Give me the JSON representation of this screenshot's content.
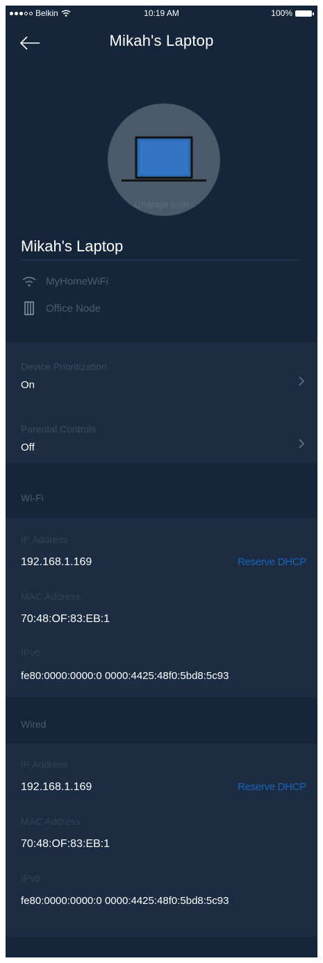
{
  "status_bar": {
    "carrier": "Belkin",
    "time": "10:19 AM",
    "battery": "100%"
  },
  "nav": {
    "title": "Mikah's Laptop"
  },
  "device": {
    "change_icon_label": "Change Icon",
    "name": "Mikah's Laptop",
    "network": "MyHomeWiFi",
    "node": "Office Node"
  },
  "settings": {
    "prioritization": {
      "label": "Device Prioritization",
      "value": "On"
    },
    "parental": {
      "label": "Parental Controls",
      "value": "Off"
    }
  },
  "wifi": {
    "header": "Wi-Fi",
    "ip_label": "IP Address",
    "ip_value": "192.168.1.169",
    "reserve_label": "Reserve DHCP",
    "mac_label": "MAC Address",
    "mac_value": "70:48:OF:83:EB:1",
    "ipv6_label": "IPv6",
    "ipv6_value": "fe80:0000:0000:0 0000:4425:48f0:5bd8:5c93"
  },
  "wired": {
    "header": "Wired",
    "ip_label": "IP Address",
    "ip_value": "192.168.1.169",
    "reserve_label": "Reserve DHCP",
    "mac_label": "MAC Address",
    "mac_value": "70:48:OF:83:EB:1",
    "ipv6_label": "IPv6",
    "ipv6_value": "fe80:0000:0000:0 0000:4425:48f0:5bd8:5c93"
  },
  "colors": {
    "background": "#15263b",
    "card": "#1c2c42",
    "link": "#1a63b8",
    "laptop_screen": "#2b6cb0"
  },
  "icons": {
    "back": "arrow-left-icon",
    "wifi": "wifi-icon",
    "node": "node-icon",
    "chevron": "chevron-right-icon",
    "device": "laptop-icon"
  }
}
